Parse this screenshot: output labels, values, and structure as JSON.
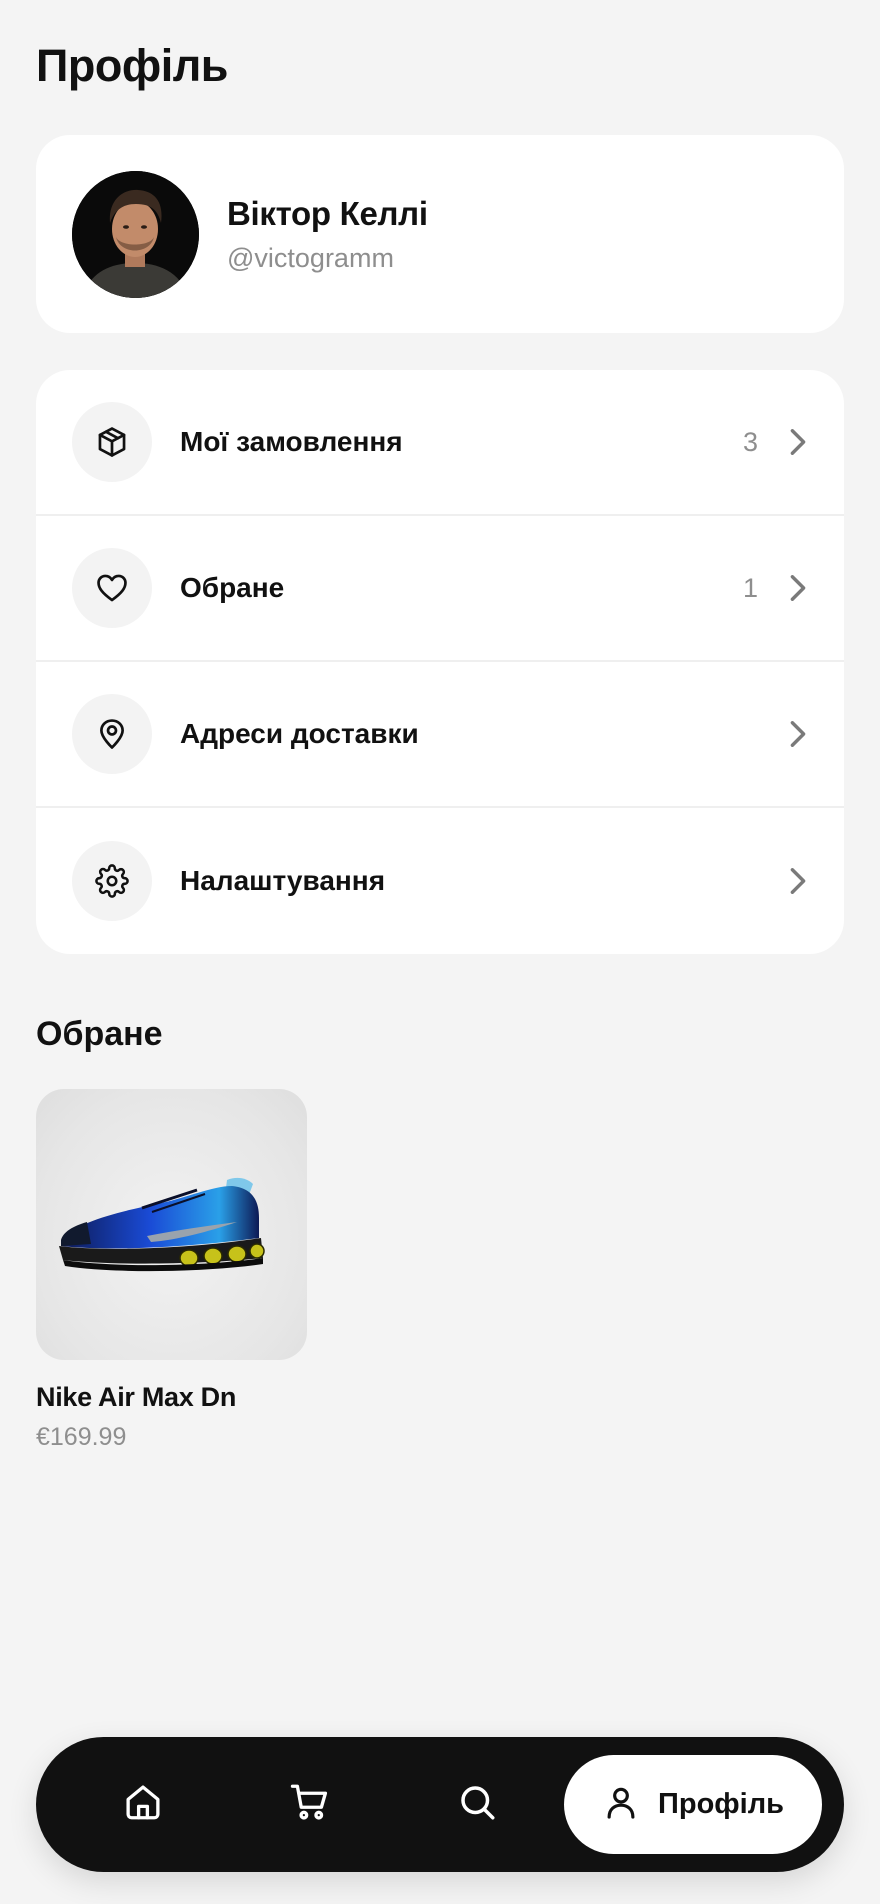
{
  "header": {
    "title": "Профіль"
  },
  "profile": {
    "name": "Віктор Келлі",
    "handle": "@victogramm",
    "avatar_icon": "user-portrait"
  },
  "menu": {
    "items": [
      {
        "label": "Мої замовлення",
        "count": "3",
        "icon": "package-icon"
      },
      {
        "label": "Обране",
        "count": "1",
        "icon": "heart-icon"
      },
      {
        "label": "Адреси доставки",
        "count": "",
        "icon": "map-pin-icon"
      },
      {
        "label": "Налаштування",
        "count": "",
        "icon": "gear-icon"
      }
    ]
  },
  "favorites": {
    "title": "Обране",
    "products": [
      {
        "name": "Nike Air Max Dn",
        "price": "€169.99"
      }
    ]
  },
  "nav": {
    "items": [
      {
        "icon": "home-icon"
      },
      {
        "icon": "cart-icon"
      },
      {
        "icon": "search-icon"
      },
      {
        "icon": "user-icon",
        "label": "Профіль",
        "active": true
      }
    ]
  },
  "colors": {
    "background": "#f4f4f4",
    "card": "#ffffff",
    "text": "#111111",
    "muted": "#8e8e8e",
    "nav_bg": "#111111"
  }
}
